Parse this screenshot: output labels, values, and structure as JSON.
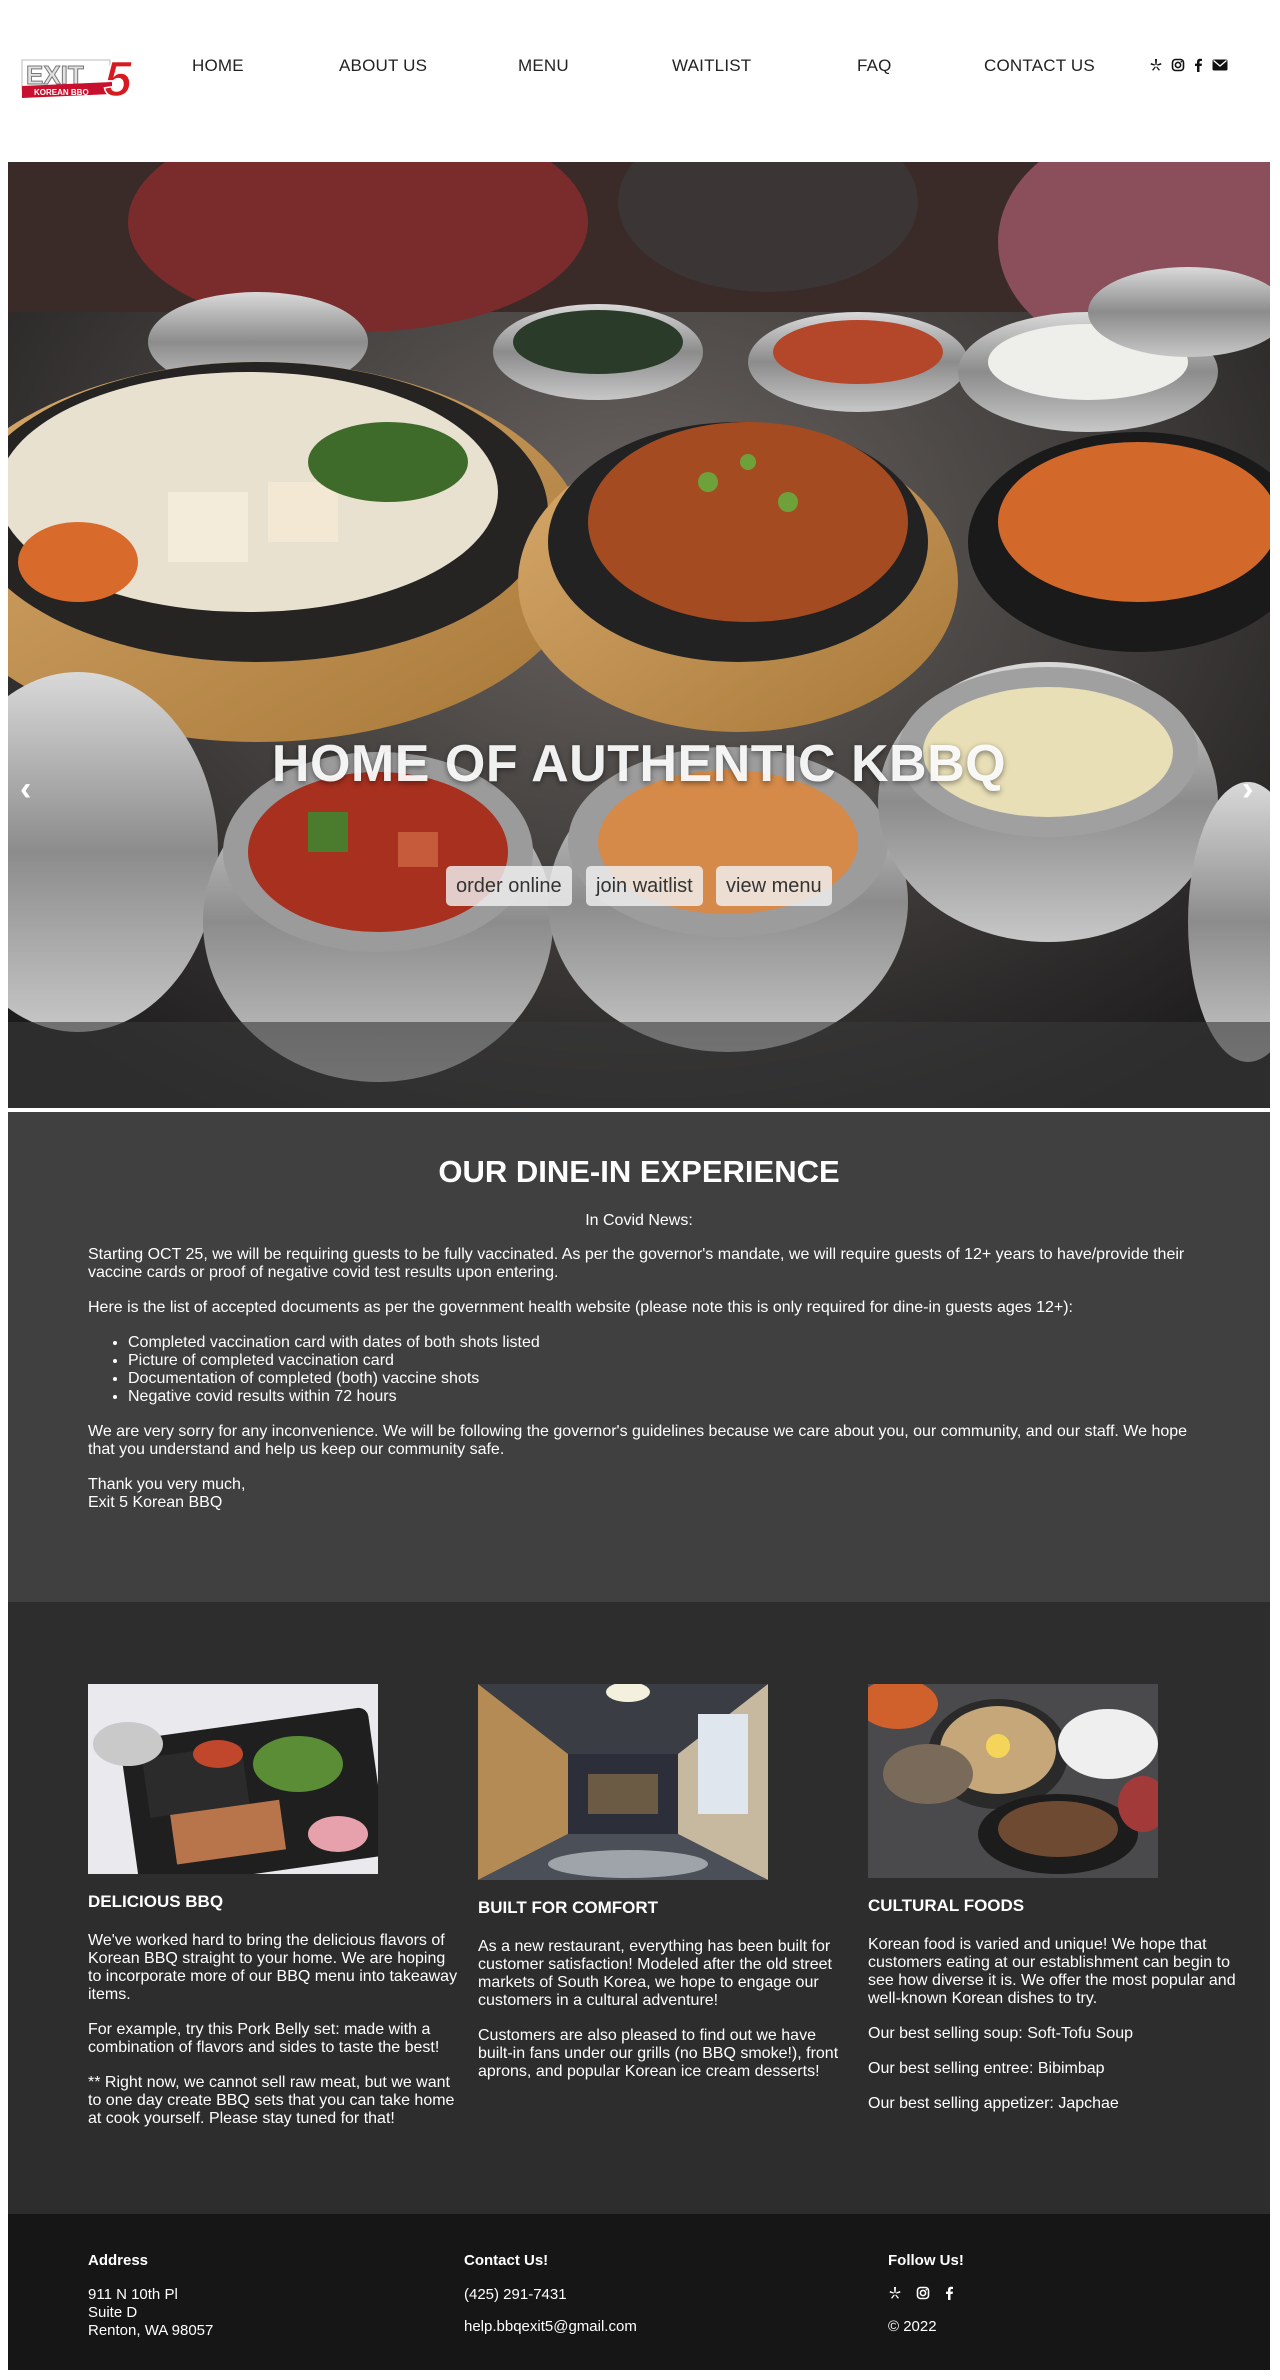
{
  "header": {
    "logo": {
      "text": "EXIT",
      "number": "5",
      "tagline": "KOREAN BBQ"
    },
    "nav": [
      {
        "label": "HOME"
      },
      {
        "label": "ABOUT US"
      },
      {
        "label": "MENU"
      },
      {
        "label": "WAITLIST"
      },
      {
        "label": "FAQ"
      },
      {
        "label": "CONTACT US"
      }
    ],
    "social_icons": [
      "yelp-icon",
      "instagram-icon",
      "facebook-icon",
      "email-icon"
    ]
  },
  "hero": {
    "title": "HOME OF AUTHENTIC KBBQ",
    "buttons": [
      {
        "label": "order online"
      },
      {
        "label": "join waitlist"
      },
      {
        "label": "view menu"
      }
    ],
    "prev_arrow": "‹",
    "next_arrow": "›"
  },
  "dinein": {
    "title": "OUR DINE-IN EXPERIENCE",
    "subtitle": "In Covid News:",
    "paragraph1": "Starting OCT 25, we will be requiring guests to be fully vaccinated. As per the governor's mandate, we will require guests of 12+ years to have/provide their vaccine cards or proof of negative covid test results upon entering.",
    "paragraph2": "Here is the list of accepted documents as per the government health website (please note this is only required for dine-in guests ages 12+):",
    "documents": [
      "Completed vaccination card with dates of both shots listed",
      "Picture of completed vaccination card",
      "Documentation of completed (both) vaccine shots",
      "Negative covid results within 72 hours"
    ],
    "paragraph3": "We are very sorry for any inconvenience. We will be following the governor's guidelines because we care about you, our community, and our staff. We hope that you understand and help us keep our community safe.",
    "signoff_line1": "Thank you very much,",
    "signoff_line2": "Exit 5 Korean BBQ"
  },
  "features": [
    {
      "title": "DELICIOUS BBQ",
      "paragraphs": [
        "We've worked hard to bring the delicious flavors of Korean BBQ straight to your home. We are hoping to incorporate more of our BBQ menu into takeaway items.",
        "For example, try this Pork Belly set: made with a combination of flavors and sides to taste the best!",
        "** Right now, we cannot sell raw meat, but we want to one day create BBQ sets that you can take home at cook yourself. Please stay tuned for that!"
      ]
    },
    {
      "title": "BUILT FOR COMFORT",
      "paragraphs": [
        "As a new restaurant, everything has been built for customer satisfaction! Modeled after the old street markets of South Korea, we hope to engage our customers in a cultural adventure!",
        "Customers are also pleased to find out we have built-in fans under our grills (no BBQ smoke!), front aprons, and popular Korean ice cream desserts!"
      ]
    },
    {
      "title": "CULTURAL FOODS",
      "paragraphs": [
        "Korean food is varied and unique! We hope that customers eating at our establishment can begin to see how diverse it is. We offer the most popular and well-known Korean dishes to try.",
        "Our best selling soup: Soft-Tofu Soup",
        "Our best selling entree: Bibimbap",
        "Our best selling appetizer: Japchae"
      ]
    }
  ],
  "footer": {
    "address": {
      "heading": "Address",
      "line1": "911 N 10th Pl",
      "line2": "Suite D",
      "line3": "Renton, WA 98057"
    },
    "contact": {
      "heading": "Contact Us!",
      "phone": "(425) 291-7431",
      "email": "help.bbqexit5@gmail.com"
    },
    "follow": {
      "heading": "Follow Us!",
      "icons": [
        "yelp-icon",
        "instagram-icon",
        "facebook-icon"
      ],
      "copyright": "© 2022"
    }
  }
}
